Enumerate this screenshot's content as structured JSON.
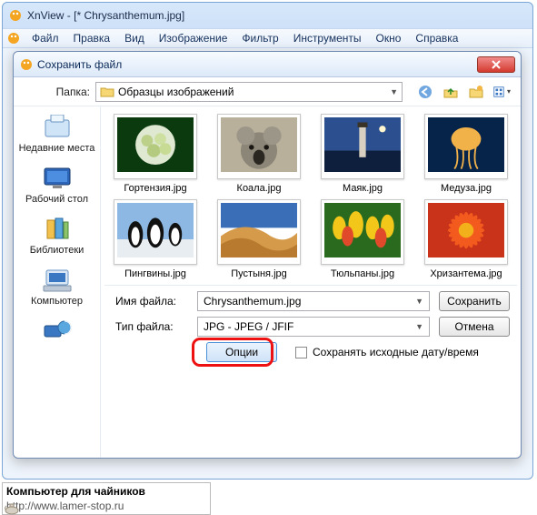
{
  "window": {
    "title": "XnView - [* Chrysanthemum.jpg]"
  },
  "menubar": [
    "Файл",
    "Правка",
    "Вид",
    "Изображение",
    "Фильтр",
    "Инструменты",
    "Окно",
    "Справка"
  ],
  "dialog": {
    "title": "Сохранить файл",
    "folder_label": "Папка:",
    "folder_value": "Образцы изображений",
    "sidebar": [
      {
        "label": "Недавние места"
      },
      {
        "label": "Рабочий стол"
      },
      {
        "label": "Библиотеки"
      },
      {
        "label": "Компьютер"
      },
      {
        "label": ""
      }
    ],
    "thumbs": [
      {
        "label": "Гортензия.jpg",
        "fill": "hydrangea"
      },
      {
        "label": "Коала.jpg",
        "fill": "koala"
      },
      {
        "label": "Маяк.jpg",
        "fill": "lighthouse"
      },
      {
        "label": "Медуза.jpg",
        "fill": "jellyfish"
      },
      {
        "label": "Пингвины.jpg",
        "fill": "penguins"
      },
      {
        "label": "Пустыня.jpg",
        "fill": "desert"
      },
      {
        "label": "Тюльпаны.jpg",
        "fill": "tulips"
      },
      {
        "label": "Хризантема.jpg",
        "fill": "chrys"
      }
    ],
    "filename_label": "Имя файла:",
    "filename_value": "Chrysanthemum.jpg",
    "filetype_label": "Тип файла:",
    "filetype_value": "JPG - JPEG / JFIF",
    "save_label": "Сохранить",
    "cancel_label": "Отмена",
    "options_label": "Опции",
    "preserve_label": "Сохранять исходные дату/время"
  },
  "footer": {
    "line1": "Компьютер для чайников",
    "line2": "http://www.lamer-stop.ru"
  }
}
